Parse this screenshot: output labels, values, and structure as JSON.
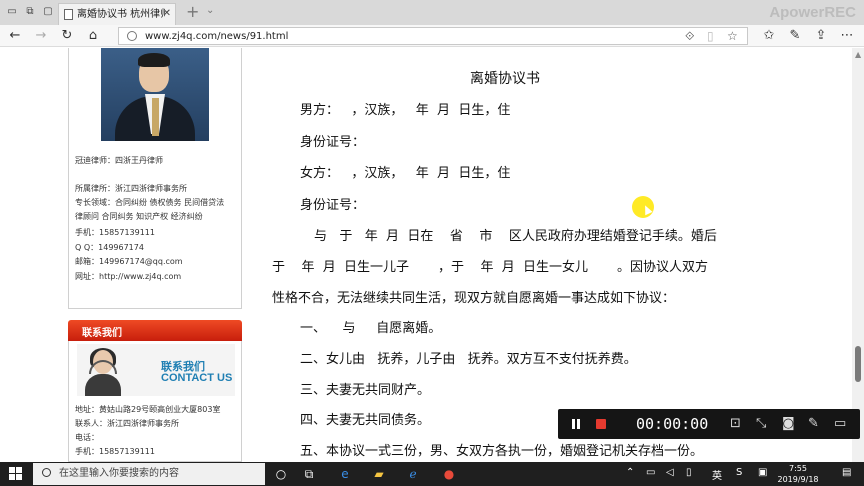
{
  "browser": {
    "tab_title": "离婚协议书 杭州律师事",
    "tab_close": "✕",
    "new_tab": "+",
    "tab_dropdown": "⌄",
    "watermark": "ApowerREC",
    "url": "www.zj4q.com/news/91.html",
    "icons": [
      "back-icon",
      "forward-icon",
      "reload-icon",
      "home-icon",
      "page-icon",
      "reading-view-icon",
      "book-icon",
      "favorite-star-icon",
      "favorites-list-icon",
      "pen-icon",
      "share-icon",
      "more-icon"
    ]
  },
  "sidebar": {
    "profile": {
      "lawyer": "冠迪律师：四浙王丹律师",
      "firm": "所属律所：浙江四浙律师事务所",
      "specialty1": "专长领域：合同纠纷 债权债务 民间借贷法",
      "specialty2": "律顾问 合同纠务 知识产权 经济纠纷",
      "phone": "手机：15857139111",
      "qq": "Q Q：149967174",
      "email": "邮箱：149967174@qq.com",
      "website": "网址：http://www.zj4q.com"
    },
    "contact": {
      "header": "联系我们",
      "banner_cn": "联系我们",
      "banner_en": "CONTACT US",
      "address": "地址：黄姑山路29号颐高创业大厦803室",
      "contact_person": "联系人：浙江四浙律师事务所",
      "tel": "电话：",
      "mobile": "手机：15857139111"
    }
  },
  "document": {
    "title": "离婚协议书",
    "lines": [
      "男方：   ，汉族，   年  月  日生，住",
      "身份证号：",
      "女方：   ，汉族，   年  月  日生，住",
      "身份证号：",
      "与   于   年  月  日在    省    市    区人民政府办理结婚登记手续。婚后",
      "于    年  月  日生一儿子       ，于    年  月  日生一女儿       。因协议人双方",
      "性格不合，无法继续共同生活，现双方就自愿离婚一事达成如下协议：",
      "一、    与     自愿离婚。",
      "二、女儿由   抚养，儿子由   抚养。双方互不支付抚养费。",
      "三、夫妻无共同财产。",
      "四、夫妻无共同债务。",
      "五、本协议一式三份，男、女双方各执一份，婚姻登记机关存档一份。"
    ]
  },
  "recorder": {
    "time": "00:00:00"
  },
  "taskbar": {
    "search_placeholder": "在这里输入你要搜索的内容",
    "ime": "英",
    "ime2": "S",
    "time": "7:55",
    "date": "2019/9/18"
  }
}
